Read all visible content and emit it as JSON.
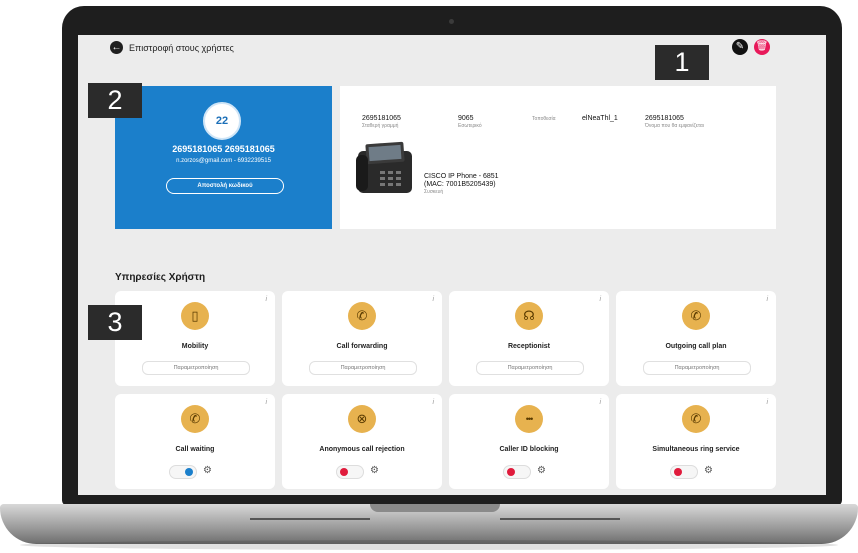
{
  "header": {
    "back_label": "Επιστροφή στους χρήστες",
    "back_icon": "arrow-left-icon",
    "edit_icon": "pencil-icon",
    "delete_icon": "trash-icon"
  },
  "callouts": [
    "1",
    "2",
    "3"
  ],
  "profile": {
    "avatar_text": "22",
    "name": "2695181065 2695181065",
    "contact": "n.zorzos@gmail.com - 6932239515",
    "send_code_label": "Αποστολή κωδικού",
    "color": "#1b7fcb"
  },
  "details": {
    "items": [
      {
        "value": "2695181065",
        "label": "Σταθερή γραμμή"
      },
      {
        "value": "9065",
        "label": "Εσωτερικό"
      },
      {
        "value": "",
        "label": "Τοποθεσία"
      },
      {
        "value": "elNeaThl_1",
        "label": ""
      },
      {
        "value": "2695181065",
        "label": "Όνομα που θα εμφανίζεται"
      }
    ],
    "device": {
      "line1": "CISCO IP Phone - 6851",
      "line2": "(MAC: 7001B5205439)",
      "label": "Συσκευή"
    }
  },
  "services": {
    "title": "Υπηρεσίες Χρήστη",
    "config_label": "Παραμετροποίηση",
    "info_symbol": "i",
    "gear_symbol": "⚙",
    "icon_color": "#e7b24f",
    "cards": [
      {
        "name": "Mobility",
        "icon": "mobile-phone-icon",
        "glyph": "▯",
        "mode": "config"
      },
      {
        "name": "Call forwarding",
        "icon": "call-forward-icon",
        "glyph": "✆",
        "mode": "config"
      },
      {
        "name": "Receptionist",
        "icon": "headset-icon",
        "glyph": "☊",
        "mode": "config"
      },
      {
        "name": "Outgoing call plan",
        "icon": "outgoing-call-icon",
        "glyph": "✆",
        "mode": "config"
      },
      {
        "name": "Call waiting",
        "icon": "call-hold-icon",
        "glyph": "✆",
        "mode": "toggle",
        "enabled": true
      },
      {
        "name": "Anonymous call rejection",
        "icon": "call-reject-icon",
        "glyph": "⊗",
        "mode": "toggle",
        "enabled": false
      },
      {
        "name": "Caller ID blocking",
        "icon": "caller-id-block-icon",
        "glyph": "•••",
        "mode": "toggle",
        "enabled": false
      },
      {
        "name": "Simultaneous ring service",
        "icon": "simultaneous-ring-icon",
        "glyph": "✆",
        "mode": "toggle",
        "enabled": false
      }
    ]
  }
}
